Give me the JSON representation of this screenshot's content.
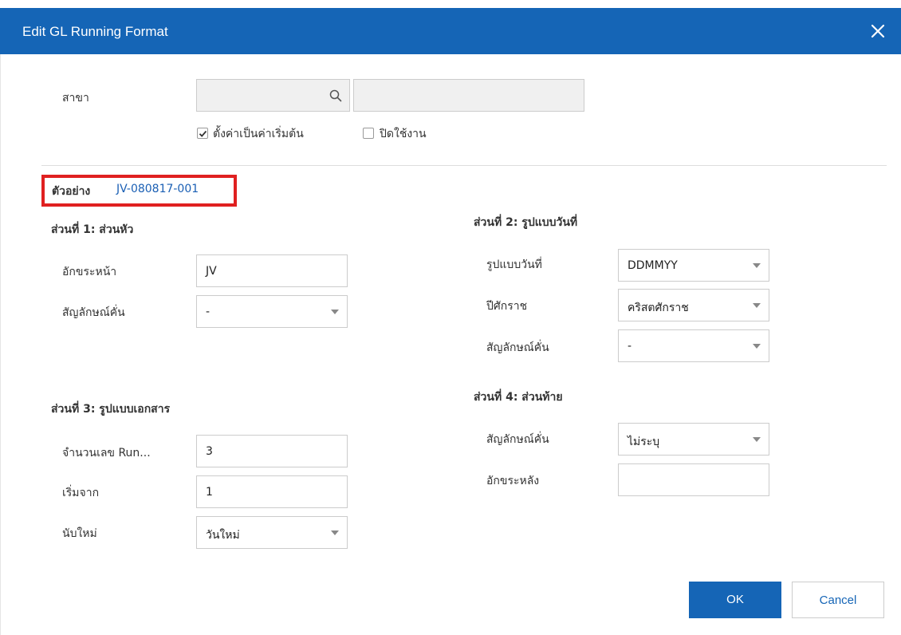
{
  "dialog": {
    "title": "Edit GL Running Format",
    "close_icon": "close-icon"
  },
  "branch": {
    "label": "สาขา",
    "code_value": "",
    "name_value": "",
    "search_icon": "search-icon"
  },
  "options": {
    "default_label": "ตั้งค่าเป็นค่าเริ่มต้น",
    "default_checked": true,
    "disable_label": "ปิดใช้งาน",
    "disable_checked": false
  },
  "example": {
    "label": "ตัวอย่าง",
    "value": "JV-080817-001"
  },
  "part1": {
    "title": "ส่วนที่ 1: ส่วนหัว",
    "prefix_label": "อักขระหน้า",
    "prefix_value": "JV",
    "separator_label": "สัญลักษณ์คั่น",
    "separator_value": "-"
  },
  "part2": {
    "title": "ส่วนที่ 2: รูปแบบวันที่",
    "date_format_label": "รูปแบบวันที่",
    "date_format_value": "DDMMYY",
    "era_label": "ปีศักราช",
    "era_value": "คริสตศักราช",
    "separator_label": "สัญลักษณ์คั่น",
    "separator_value": "-"
  },
  "part3": {
    "title": "ส่วนที่ 3: รูปแบบเอกสาร",
    "running_label": "จำนวนเลข Run...",
    "running_value": "3",
    "start_label": "เริ่มจาก",
    "start_value": "1",
    "reset_label": "นับใหม่",
    "reset_value": "วันใหม่"
  },
  "part4": {
    "title": "ส่วนที่ 4: ส่วนท้าย",
    "separator_label": "สัญลักษณ์คั่น",
    "separator_value": "ไม่ระบุ",
    "suffix_label": "อักขระหลัง",
    "suffix_value": ""
  },
  "buttons": {
    "ok": "OK",
    "cancel": "Cancel"
  },
  "colors": {
    "header": "#1565b6",
    "highlight": "#e02020",
    "example_value": "#1a5fb4"
  }
}
